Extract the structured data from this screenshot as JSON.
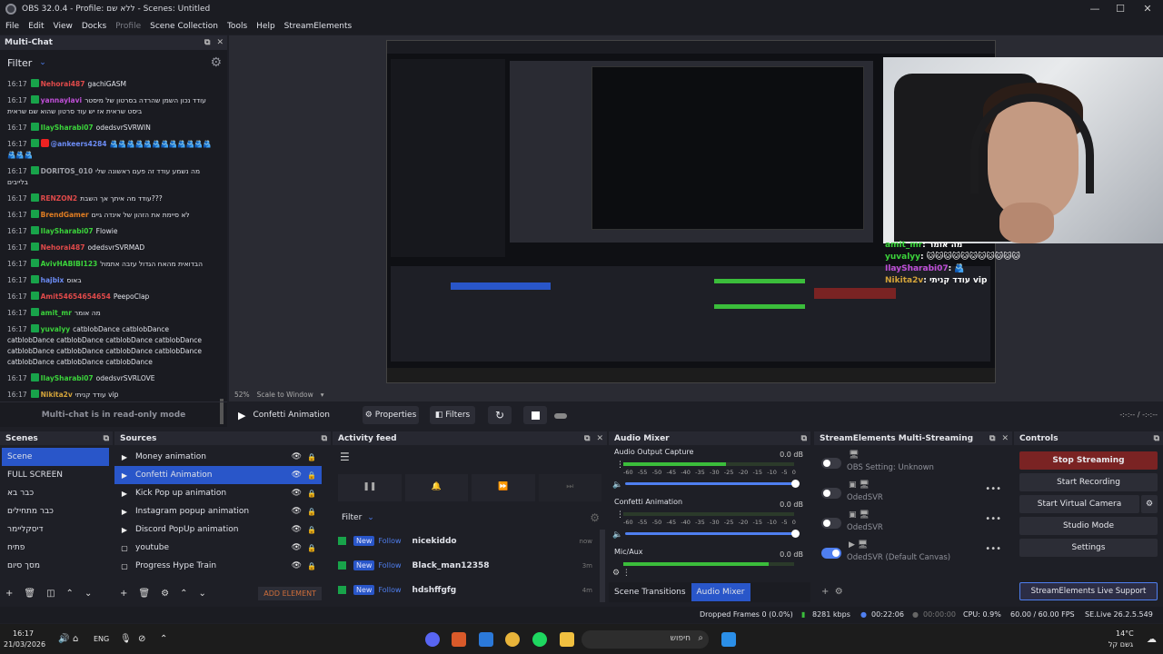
{
  "window": {
    "title": "OBS 32.0.4 - Profile: ללא שם - Scenes: Untitled"
  },
  "menu": [
    "File",
    "Edit",
    "View",
    "Docks",
    "Profile",
    "Scene Collection",
    "Tools",
    "Help",
    "StreamElements"
  ],
  "chat": {
    "title": "Multi-Chat",
    "filter_label": "Filter",
    "readonly": "Multi-chat is in read-only mode",
    "messages": [
      {
        "time": "16:17",
        "name": "Nehorai487",
        "color": "#e04a4a",
        "text": "gachiGASM",
        "src": "tw"
      },
      {
        "time": "16:17",
        "name": "yannaylavi",
        "color": "#c04fd8",
        "text": "עודד נכון השמן שהרדה בסרטון של מיסטר ביסט שראית אז יש עוד סרטון שהוא שם שראית",
        "src": "tw"
      },
      {
        "time": "16:17",
        "name": "IlaySharabi07",
        "color": "#3bd33b",
        "text": "odedsvrSVRWIN",
        "src": "tw"
      },
      {
        "time": "16:17",
        "name": "@ankeers4284",
        "color": "#6c8cf5",
        "text": "🫂🫂🫂🫂🫂🫂🫂🫂🫂🫂🫂🫂🫂🫂🫂",
        "src": "yt"
      },
      {
        "time": "16:17",
        "name": "DORITOS_010",
        "color": "#9ea0a8",
        "text": "מה נשמע עודד זה פעם ראשונה שלי בלייבים",
        "src": "tw"
      },
      {
        "time": "16:17",
        "name": "RENZON2",
        "color": "#e04a4a",
        "text": "עודד מה איתך אך השבת???",
        "src": "tw"
      },
      {
        "time": "16:17",
        "name": "BrendGamer",
        "color": "#e07d22",
        "text": "לא סיימת את הזהון של אינדה גיים",
        "src": "tw"
      },
      {
        "time": "16:17",
        "name": "IlaySharabi07",
        "color": "#3bd33b",
        "text": "Flowie",
        "src": "tw"
      },
      {
        "time": "16:17",
        "name": "Nehorai487",
        "color": "#e04a4a",
        "text": "odedsvrSVRMAD",
        "src": "tw"
      },
      {
        "time": "16:17",
        "name": "AvivHABIBI123",
        "color": "#3bd33b",
        "text": "הבדואית מהאח הגדול עזבה אתמול",
        "src": "tw"
      },
      {
        "time": "16:17",
        "name": "hajbix",
        "color": "#6c8cf5",
        "text": "באוס",
        "src": "tw"
      },
      {
        "time": "16:17",
        "name": "Amit54654654654",
        "color": "#e04a4a",
        "text": "PeepoClap",
        "src": "tw"
      },
      {
        "time": "16:17",
        "name": "amit_mr",
        "color": "#3bd33b",
        "text": "מה אומר",
        "src": "tw"
      },
      {
        "time": "16:17",
        "name": "yuvalyy",
        "color": "#3bd33b",
        "text": "catblobDance catblobDance catblobDance catblobDance catblobDance catblobDance catblobDance catblobDance catblobDance catblobDance catblobDance catblobDance catblobDance",
        "src": "tw"
      },
      {
        "time": "16:17",
        "name": "IlaySharabi07",
        "color": "#3bd33b",
        "text": "odedsvrSVRLOVE",
        "src": "tw"
      },
      {
        "time": "16:17",
        "name": "Nikita2v",
        "color": "#d4a43a",
        "text": "עודד קניתי vip",
        "src": "tw"
      }
    ]
  },
  "preview": {
    "zoom": "52%",
    "scale_label": "Scale to Window",
    "overlay": [
      {
        "name": "amit_mr",
        "text": ": מה אומר",
        "color": "#3bd33b"
      },
      {
        "name": "yuvalyy",
        "text": ": 🐱🐱🐱🐱🐱🐱🐱🐱🐱🐱🐱",
        "color": "#3bd33b"
      },
      {
        "name": "IlaySharabi07",
        "text": ": 🫂",
        "color": "#c04fd8"
      },
      {
        "name": "Nikita2v",
        "text": ": עודד קניתי vip",
        "color": "#d4a43a"
      }
    ]
  },
  "transport": {
    "scene": "Confetti Animation",
    "properties": "Properties",
    "filters": "Filters",
    "time": "-:-:-- / -:-:--"
  },
  "scenes": {
    "title": "Scenes",
    "items": [
      "Scene",
      "FULL SCREEN",
      "כבר בא",
      "כבר מתחילים",
      "דיסקליימר",
      "פתיח",
      "מסך סיום"
    ],
    "selected": 0
  },
  "sources": {
    "title": "Sources",
    "items": [
      {
        "name": "Money animation",
        "icon": "▶"
      },
      {
        "name": "Confetti Animation",
        "icon": "▶"
      },
      {
        "name": "Kick Pop up animation",
        "icon": "▶"
      },
      {
        "name": "Instagram popup animation",
        "icon": "▶"
      },
      {
        "name": "Discord PopUp animation",
        "icon": "▶"
      },
      {
        "name": "youtube",
        "icon": "▢"
      },
      {
        "name": "Progress Hype Train",
        "icon": "▢"
      }
    ],
    "selected": 1,
    "add_element": "ADD ELEMENT"
  },
  "activity": {
    "title": "Activity feed",
    "filter": "Filter",
    "items": [
      {
        "badge": "New",
        "action": "Follow",
        "name": "nicekiddo",
        "ago": "now"
      },
      {
        "badge": "New",
        "action": "Follow",
        "name": "Black_man12358",
        "ago": "3m"
      },
      {
        "badge": "New",
        "action": "Follow",
        "name": "hdshffgfg",
        "ago": "4m"
      }
    ]
  },
  "mixer": {
    "title": "Audio Mixer",
    "channels": [
      {
        "name": "Audio Output Capture",
        "db": "0.0 dB",
        "level": 0.6
      },
      {
        "name": "Confetti Animation",
        "db": "0.0 dB",
        "level": 0
      },
      {
        "name": "Mic/Aux",
        "db": "0.0 dB",
        "level": 0.85
      }
    ],
    "scale": [
      "-60",
      "-55",
      "-50",
      "-45",
      "-40",
      "-35",
      "-30",
      "-25",
      "-20",
      "-15",
      "-10",
      "-5",
      "0"
    ],
    "tab_transitions": "Scene Transitions",
    "tab_mixer": "Audio Mixer"
  },
  "se": {
    "title": "StreamElements Multi-Streaming",
    "rows": [
      {
        "label": "OBS Setting: Unknown",
        "on": false
      },
      {
        "label": "OdedSVR",
        "on": false
      },
      {
        "label": "OdedSVR",
        "on": false
      },
      {
        "label": "OdedSVR (Default Canvas)",
        "on": true
      }
    ]
  },
  "controls": {
    "title": "Controls",
    "stop_streaming": "Stop Streaming",
    "start_recording": "Start Recording",
    "start_virtual_camera": "Start Virtual Camera",
    "studio_mode": "Studio Mode",
    "settings": "Settings",
    "live_support": "StreamElements Live Support"
  },
  "status": {
    "dropped": "Dropped Frames 0 (0.0%)",
    "kbps": "8281 kbps",
    "live": "00:22:06",
    "rec": "00:00:00",
    "cpu": "CPU: 0.9%",
    "fps": "60.00 / 60.00 FPS",
    "version": "SE.Live 26.2.5.549"
  },
  "taskbar": {
    "time": "16:17",
    "date": "21/03/2026",
    "lang": "ENG",
    "search": "חיפוש",
    "temp": "14°C",
    "weather": "גשם קל"
  }
}
